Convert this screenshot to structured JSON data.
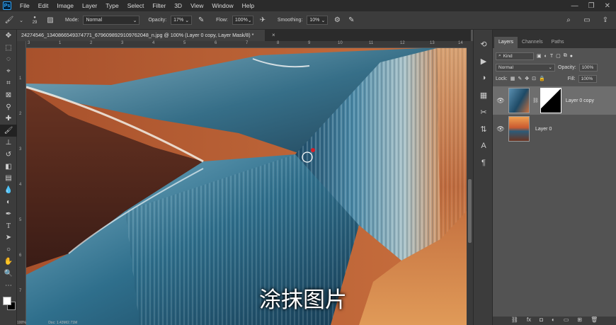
{
  "menubar": {
    "items": [
      "File",
      "Edit",
      "Image",
      "Layer",
      "Type",
      "Select",
      "Filter",
      "3D",
      "View",
      "Window",
      "Help"
    ]
  },
  "options": {
    "brush_size": "29",
    "mode_label": "Mode:",
    "mode_value": "Normal",
    "opacity_label": "Opacity:",
    "opacity_value": "17%",
    "flow_label": "Flow:",
    "flow_value": "100%",
    "smoothing_label": "Smoothing:",
    "smoothing_value": "10%"
  },
  "document": {
    "tab_title": "24274546_1340866549374771_6796098929109762048_n.jpg @ 100% (Layer 0 copy, Layer Mask/8) *",
    "close": "×"
  },
  "ruler": {
    "top": [
      "3",
      "1",
      "2",
      "3",
      "4",
      "5",
      "6",
      "7",
      "8",
      "9",
      "10",
      "11",
      "12",
      "13",
      "14"
    ],
    "left": [
      "1",
      "2",
      "3",
      "4",
      "5",
      "6",
      "7"
    ]
  },
  "subtitle": "涂抹图片",
  "status": {
    "zoom": "100%",
    "doc": "Doc: 1.43M/2.71M"
  },
  "layers_panel": {
    "tabs": [
      "Layers",
      "Channels",
      "Paths"
    ],
    "filter_value": "Kind",
    "blend_mode": "Normal",
    "opacity_label": "Opacity:",
    "opacity_value": "100%",
    "lock_label": "Lock:",
    "fill_label": "Fill:",
    "fill_value": "100%",
    "layers": [
      {
        "name": "Layer 0 copy",
        "selected": true
      },
      {
        "name": "Layer 0",
        "selected": false
      }
    ],
    "bottom_icons": [
      "link-icon",
      "fx-icon",
      "mask-icon",
      "adjustment-icon",
      "group-icon",
      "new-layer-icon",
      "trash-icon"
    ],
    "fx_text": "fx"
  },
  "colors": {
    "accent": "#31a8ff",
    "foreground": "#ffffff",
    "background": "#000000"
  }
}
